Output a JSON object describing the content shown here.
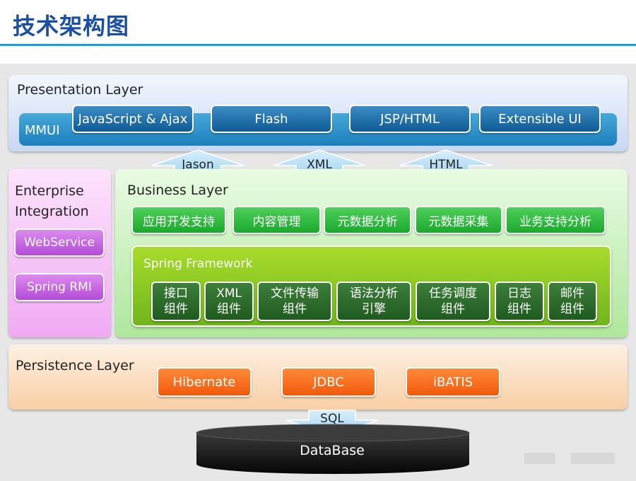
{
  "title": "技术架构图",
  "presentation": {
    "label": "Presentation Layer",
    "mmui": "MMUI",
    "items": [
      "JavaScript & Ajax",
      "Flash",
      "JSP/HTML",
      "Extensible UI"
    ]
  },
  "transfers": [
    "Jason",
    "XML",
    "HTML"
  ],
  "enterprise": {
    "label": "Enterprise\nIntegration",
    "label_line1": "Enterprise",
    "label_line2": "Integration",
    "items": [
      "WebService",
      "Spring RMI"
    ]
  },
  "business": {
    "label": "Business Layer",
    "items": [
      "应用开发支持",
      "内容管理",
      "元数据分析",
      "元数据采集",
      "业务支持分析"
    ]
  },
  "spring": {
    "label": "Spring Framework",
    "items": [
      "接口\n组件",
      "XML\n组件",
      "文件传输\n组件",
      "语法分析\n引擎",
      "任务调度\n组件",
      "日志\n组件",
      "邮件\n组件"
    ]
  },
  "persistence": {
    "label": "Persistence Layer",
    "items": [
      "Hibernate",
      "JDBC",
      "iBATIS"
    ]
  },
  "sql": "SQL",
  "database": "DataBase",
  "colors": {
    "title": "#1a4fa3",
    "presentation": "#0f5b94",
    "enterprise": "#b44cd6",
    "business": "#1aa82d",
    "spring": "#6fb51c",
    "persistence": "#f05a0a"
  }
}
